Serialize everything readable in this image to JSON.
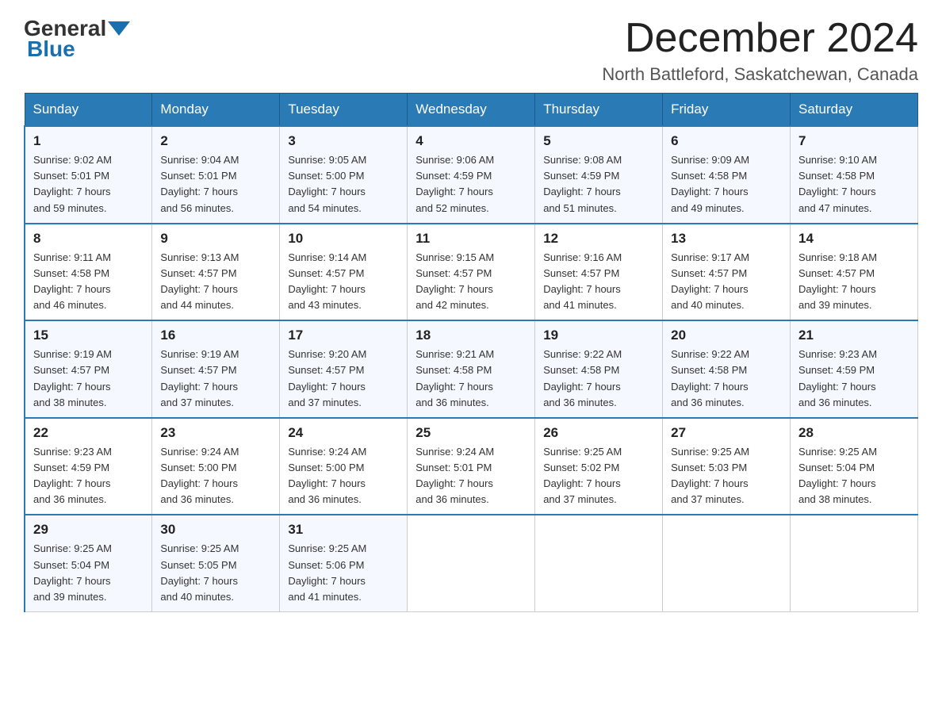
{
  "header": {
    "logo_general": "General",
    "logo_blue": "Blue",
    "month_title": "December 2024",
    "location": "North Battleford, Saskatchewan, Canada"
  },
  "weekdays": [
    "Sunday",
    "Monday",
    "Tuesday",
    "Wednesday",
    "Thursday",
    "Friday",
    "Saturday"
  ],
  "weeks": [
    [
      {
        "day": "1",
        "sunrise": "9:02 AM",
        "sunset": "5:01 PM",
        "daylight": "7 hours and 59 minutes."
      },
      {
        "day": "2",
        "sunrise": "9:04 AM",
        "sunset": "5:01 PM",
        "daylight": "7 hours and 56 minutes."
      },
      {
        "day": "3",
        "sunrise": "9:05 AM",
        "sunset": "5:00 PM",
        "daylight": "7 hours and 54 minutes."
      },
      {
        "day": "4",
        "sunrise": "9:06 AM",
        "sunset": "4:59 PM",
        "daylight": "7 hours and 52 minutes."
      },
      {
        "day": "5",
        "sunrise": "9:08 AM",
        "sunset": "4:59 PM",
        "daylight": "7 hours and 51 minutes."
      },
      {
        "day": "6",
        "sunrise": "9:09 AM",
        "sunset": "4:58 PM",
        "daylight": "7 hours and 49 minutes."
      },
      {
        "day": "7",
        "sunrise": "9:10 AM",
        "sunset": "4:58 PM",
        "daylight": "7 hours and 47 minutes."
      }
    ],
    [
      {
        "day": "8",
        "sunrise": "9:11 AM",
        "sunset": "4:58 PM",
        "daylight": "7 hours and 46 minutes."
      },
      {
        "day": "9",
        "sunrise": "9:13 AM",
        "sunset": "4:57 PM",
        "daylight": "7 hours and 44 minutes."
      },
      {
        "day": "10",
        "sunrise": "9:14 AM",
        "sunset": "4:57 PM",
        "daylight": "7 hours and 43 minutes."
      },
      {
        "day": "11",
        "sunrise": "9:15 AM",
        "sunset": "4:57 PM",
        "daylight": "7 hours and 42 minutes."
      },
      {
        "day": "12",
        "sunrise": "9:16 AM",
        "sunset": "4:57 PM",
        "daylight": "7 hours and 41 minutes."
      },
      {
        "day": "13",
        "sunrise": "9:17 AM",
        "sunset": "4:57 PM",
        "daylight": "7 hours and 40 minutes."
      },
      {
        "day": "14",
        "sunrise": "9:18 AM",
        "sunset": "4:57 PM",
        "daylight": "7 hours and 39 minutes."
      }
    ],
    [
      {
        "day": "15",
        "sunrise": "9:19 AM",
        "sunset": "4:57 PM",
        "daylight": "7 hours and 38 minutes."
      },
      {
        "day": "16",
        "sunrise": "9:19 AM",
        "sunset": "4:57 PM",
        "daylight": "7 hours and 37 minutes."
      },
      {
        "day": "17",
        "sunrise": "9:20 AM",
        "sunset": "4:57 PM",
        "daylight": "7 hours and 37 minutes."
      },
      {
        "day": "18",
        "sunrise": "9:21 AM",
        "sunset": "4:58 PM",
        "daylight": "7 hours and 36 minutes."
      },
      {
        "day": "19",
        "sunrise": "9:22 AM",
        "sunset": "4:58 PM",
        "daylight": "7 hours and 36 minutes."
      },
      {
        "day": "20",
        "sunrise": "9:22 AM",
        "sunset": "4:58 PM",
        "daylight": "7 hours and 36 minutes."
      },
      {
        "day": "21",
        "sunrise": "9:23 AM",
        "sunset": "4:59 PM",
        "daylight": "7 hours and 36 minutes."
      }
    ],
    [
      {
        "day": "22",
        "sunrise": "9:23 AM",
        "sunset": "4:59 PM",
        "daylight": "7 hours and 36 minutes."
      },
      {
        "day": "23",
        "sunrise": "9:24 AM",
        "sunset": "5:00 PM",
        "daylight": "7 hours and 36 minutes."
      },
      {
        "day": "24",
        "sunrise": "9:24 AM",
        "sunset": "5:00 PM",
        "daylight": "7 hours and 36 minutes."
      },
      {
        "day": "25",
        "sunrise": "9:24 AM",
        "sunset": "5:01 PM",
        "daylight": "7 hours and 36 minutes."
      },
      {
        "day": "26",
        "sunrise": "9:25 AM",
        "sunset": "5:02 PM",
        "daylight": "7 hours and 37 minutes."
      },
      {
        "day": "27",
        "sunrise": "9:25 AM",
        "sunset": "5:03 PM",
        "daylight": "7 hours and 37 minutes."
      },
      {
        "day": "28",
        "sunrise": "9:25 AM",
        "sunset": "5:04 PM",
        "daylight": "7 hours and 38 minutes."
      }
    ],
    [
      {
        "day": "29",
        "sunrise": "9:25 AM",
        "sunset": "5:04 PM",
        "daylight": "7 hours and 39 minutes."
      },
      {
        "day": "30",
        "sunrise": "9:25 AM",
        "sunset": "5:05 PM",
        "daylight": "7 hours and 40 minutes."
      },
      {
        "day": "31",
        "sunrise": "9:25 AM",
        "sunset": "5:06 PM",
        "daylight": "7 hours and 41 minutes."
      },
      null,
      null,
      null,
      null
    ]
  ],
  "labels": {
    "sunrise": "Sunrise:",
    "sunset": "Sunset:",
    "daylight": "Daylight:"
  }
}
